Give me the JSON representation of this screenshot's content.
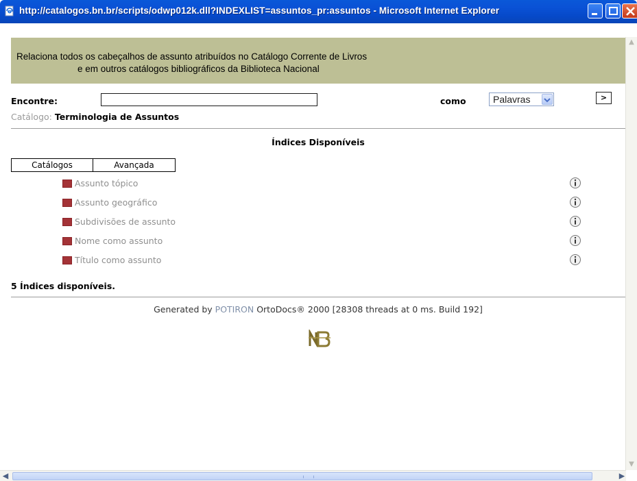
{
  "window": {
    "title": "http://catalogos.bn.br/scripts/odwp012k.dll?INDEXLIST=assuntos_pr:assuntos - Microsoft Internet Explorer",
    "accent": "#0a52d6"
  },
  "header": {
    "line1": "Relaciona todos os cabeçalhos de assunto atribuídos no Catálogo Corrente de Livros",
    "line2": "e em outros catálogos bibliográficos da Biblioteca Nacional",
    "background": "#bdbf95"
  },
  "search": {
    "label": "Encontre:",
    "value": "",
    "como_label": "como",
    "mode_selected": "Palavras",
    "go_label": ">"
  },
  "catalog": {
    "key": "Catálogo:",
    "value": "Terminologia de Assuntos"
  },
  "indices": {
    "title": "Índices Disponíveis",
    "tabs": [
      "Catálogos",
      "Avançada"
    ],
    "items": [
      {
        "label": "Assunto tópico"
      },
      {
        "label": "Assunto geográfico"
      },
      {
        "label": "Subdivisões de assunto"
      },
      {
        "label": "Nome como assunto"
      },
      {
        "label": "Título como assunto"
      }
    ],
    "count_text": "5 Índices disponíveis."
  },
  "footer": {
    "prefix": "Generated by ",
    "brand": "POTIRON",
    "suffix": " OrtoDocs® 2000 [28308 threads at 0 ms. Build 192]"
  },
  "icons": {
    "info": "info-icon",
    "index_bullet": "red-square-icon",
    "logo": "bn-logo-icon"
  }
}
